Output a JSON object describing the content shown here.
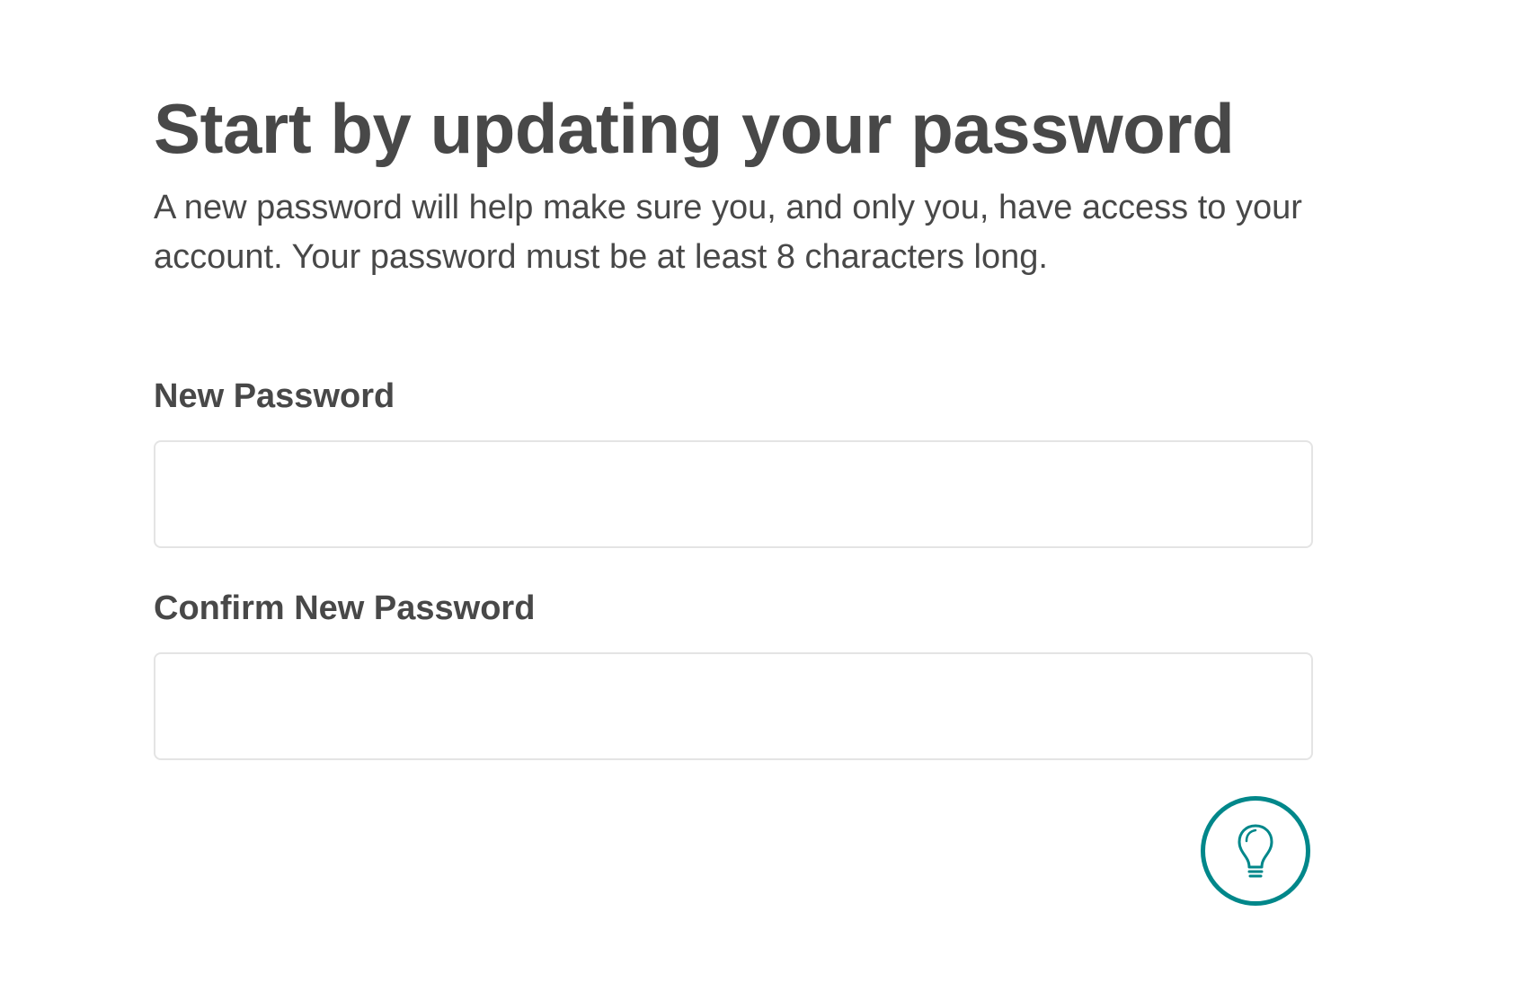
{
  "header": {
    "title": "Start by updating your password",
    "subtitle": "A new password will help make sure you, and only you, have access to your account. Your password must be at least 8 characters long."
  },
  "form": {
    "new_password": {
      "label": "New Password",
      "value": "",
      "placeholder": ""
    },
    "confirm_password": {
      "label": "Confirm New Password",
      "value": "",
      "placeholder": ""
    }
  },
  "tip_button": {
    "icon": "lightbulb-icon",
    "color": "#00878a"
  },
  "colors": {
    "text": "#484848",
    "field_border": "#e4e4e4",
    "accent": "#00878a"
  }
}
